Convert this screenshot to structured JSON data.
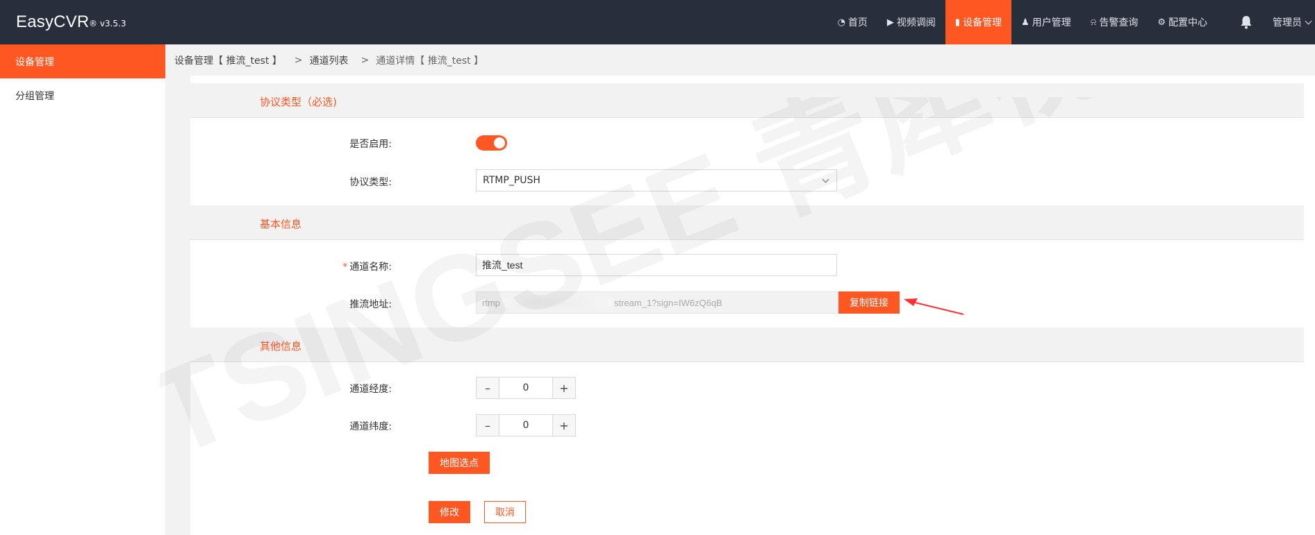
{
  "app": {
    "name": "EasyCVR",
    "version": "® v3.5.3"
  },
  "nav": [
    {
      "label": "首页",
      "icon": "dashboard-icon",
      "glyph": "◔"
    },
    {
      "label": "视频调阅",
      "icon": "play-circle-icon",
      "glyph": "▶"
    },
    {
      "label": "设备管理",
      "icon": "device-icon",
      "glyph": "▮"
    },
    {
      "label": "用户管理",
      "icon": "user-icon",
      "glyph": "♟"
    },
    {
      "label": "告警查询",
      "icon": "alarm-icon",
      "glyph": "⍾"
    },
    {
      "label": "配置中心",
      "icon": "gear-icon",
      "glyph": "⚙"
    }
  ],
  "user": {
    "label": "管理员"
  },
  "sidebar": {
    "items": [
      {
        "label": "设备管理"
      },
      {
        "label": "分组管理"
      }
    ]
  },
  "breadcrumb": {
    "root": "设备管理【 推流_test 】",
    "middle": "通道列表",
    "last": "通道详情【 推流_test 】",
    "sep": ">"
  },
  "sections": {
    "protocol": "协议类型（必选)",
    "basic": "基本信息",
    "other": "其他信息"
  },
  "form": {
    "enabled_label": "是否启用:",
    "protocol_label": "协议类型:",
    "protocol_value": "RTMP_PUSH",
    "name_required": "*",
    "name_label": "通道名称:",
    "name_value": "推流_test",
    "push_label": "推流地址:",
    "push_prefix": "rtmp",
    "push_suffix": "stream_1?sign=IW6zQ6qB",
    "copy_button": "复制链接",
    "lng_label": "通道经度:",
    "lng_value": "0",
    "lat_label": "通道纬度:",
    "lat_value": "0",
    "minus": "–",
    "plus": "+",
    "map_button": "地图选点",
    "submit_button": "修改",
    "cancel_button": "取消"
  },
  "watermark": {
    "text": "TSINGSEE 青犀视频"
  },
  "colors": {
    "accent": "#ff5722",
    "topbar": "#272e3c",
    "panel": "#f2f2f2"
  }
}
